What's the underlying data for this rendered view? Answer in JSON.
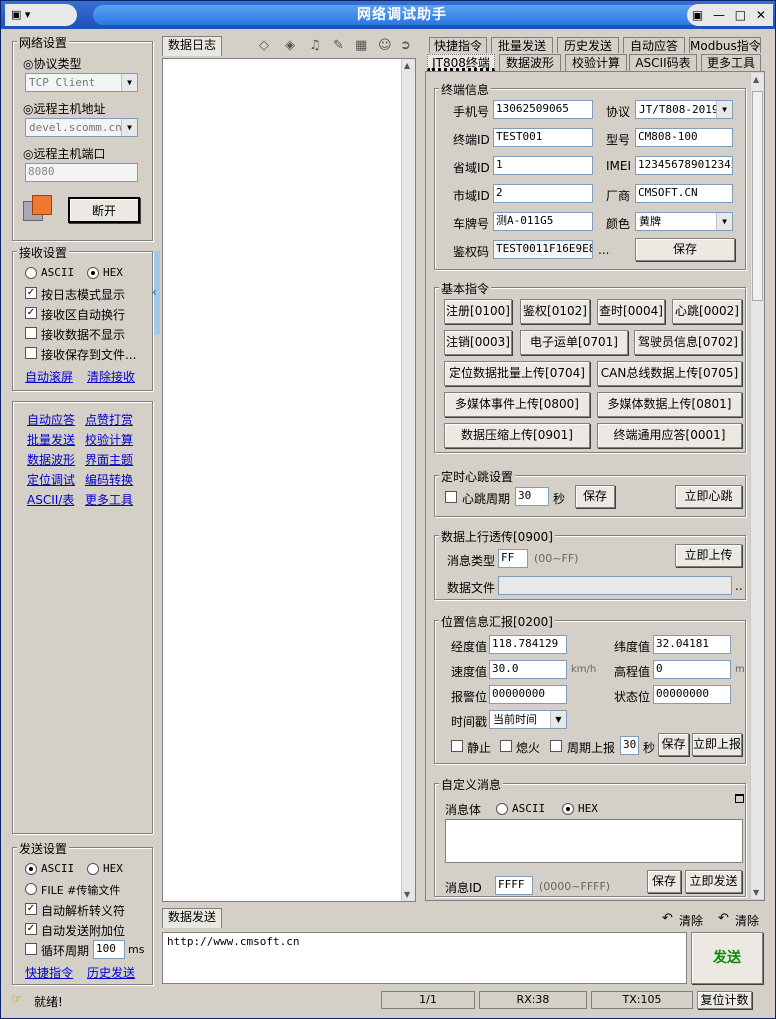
{
  "window": {
    "title": "网络调试助手",
    "controls": "▣ — □ ✕"
  },
  "network": {
    "group": "网络设置",
    "protocol_label": "◎协议类型",
    "protocol_value": "TCP Client",
    "host_label": "◎远程主机地址",
    "host_value": "devel.scomm.cn",
    "port_label": "◎远程主机端口",
    "port_value": "8080",
    "disconnect": "断开"
  },
  "receive": {
    "group": "接收设置",
    "ascii": "ASCII",
    "hex": "HEX",
    "opt1": "按日志模式显示",
    "opt2": "接收区自动换行",
    "opt3": "接收数据不显示",
    "opt4": "接收保存到文件...",
    "autoscroll": "自动滚屏",
    "clear": "清除接收"
  },
  "quick": {
    "l1": "自动应答",
    "l2": "点赞打赏",
    "l3": "批量发送",
    "l4": "校验计算",
    "l5": "数据波形",
    "l6": "界面主题",
    "l7": "定位调试",
    "l8": "编码转换",
    "l9": "ASCII/表",
    "l10": "更多工具"
  },
  "send_settings": {
    "group": "发送设置",
    "ascii": "ASCII",
    "hex": "HEX",
    "file": "FILE #传输文件",
    "opt1": "自动解析转义符",
    "opt2": "自动发送附加位",
    "loop": "循环周期",
    "loop_value": "100",
    "ms": "ms",
    "link1": "快捷指令",
    "link2": "历史发送"
  },
  "log": {
    "tab": "数据日志"
  },
  "send_area": {
    "tab": "数据发送",
    "clear1": "清除",
    "clear2": "清除",
    "content": "http://www.cmsoft.cn",
    "send": "发送"
  },
  "status": {
    "ready": "就绪!",
    "page": "1/1",
    "rx": "RX:38",
    "tx": "TX:105",
    "reset": "复位计数"
  },
  "tabs_row1": [
    "快捷指令",
    "批量发送",
    "历史发送",
    "自动应答",
    "Modbus指令"
  ],
  "tabs_row2": [
    "JT808终端",
    "数据波形",
    "校验计算",
    "ASCII码表",
    "更多工具"
  ],
  "terminal": {
    "group": "终端信息",
    "phone_label": "手机号",
    "phone": "13062509065",
    "proto_label": "协议",
    "proto": "JT/T808-2019",
    "tid_label": "终端ID",
    "tid": "TEST001",
    "model_label": "型号",
    "model": "CM808-100",
    "prov_label": "省域ID",
    "prov": "1",
    "imei_label": "IMEI",
    "imei": "123456789012345",
    "city_label": "市域ID",
    "city": "2",
    "maker_label": "厂商",
    "maker": "CMSOFT.CN",
    "plate_label": "车牌号",
    "plate": "测A-011G5",
    "color_label": "颜色",
    "color": "黄牌",
    "auth_label": "鉴权码",
    "auth": "TEST0011F16E9E8",
    "auth_more": "...",
    "save": "保存"
  },
  "basic": {
    "group": "基本指令",
    "b1": "注册[0100]",
    "b2": "鉴权[0102]",
    "b3": "查时[0004]",
    "b4": "心跳[0002]",
    "b5": "注销[0003]",
    "b6": "电子运单[0701]",
    "b7": "驾驶员信息[0702]",
    "b8": "定位数据批量上传[0704]",
    "b9": "CAN总线数据上传[0705]",
    "b10": "多媒体事件上传[0800]",
    "b11": "多媒体数据上传[0801]",
    "b12": "数据压缩上传[0901]",
    "b13": "终端通用应答[0001]"
  },
  "heartbeat": {
    "group": "定时心跳设置",
    "label": "心跳周期",
    "value": "30",
    "unit": "秒",
    "save": "保存",
    "now": "立即心跳"
  },
  "uplink": {
    "group": "数据上行透传[0900]",
    "type_label": "消息类型",
    "type": "FF",
    "range": "(00~FF)",
    "now": "立即上传",
    "file_label": "数据文件",
    "dots": ".."
  },
  "location": {
    "group": "位置信息汇报[0200]",
    "lon_label": "经度值",
    "lon": "118.784129",
    "lat_label": "纬度值",
    "lat": "32.04181",
    "spd_label": "速度值",
    "spd": "30.0",
    "spd_unit": "km/h",
    "alt_label": "高程值",
    "alt": "0",
    "alt_unit": "m",
    "alarm_label": "报警位",
    "alarm": "00000000",
    "state_label": "状态位",
    "state": "00000000",
    "time_label": "时间戳",
    "time": "当前时间",
    "stop": "静止",
    "off": "熄火",
    "period": "周期上报",
    "period_val": "30",
    "sec": "秒",
    "save": "保存",
    "now": "立即上报"
  },
  "custom": {
    "group": "自定义消息",
    "body_label": "消息体",
    "ascii": "ASCII",
    "hex": "HEX",
    "id_label": "消息ID",
    "id": "FFFF",
    "range": "(0000~FFFF)",
    "save": "保存",
    "now": "立即发送"
  }
}
